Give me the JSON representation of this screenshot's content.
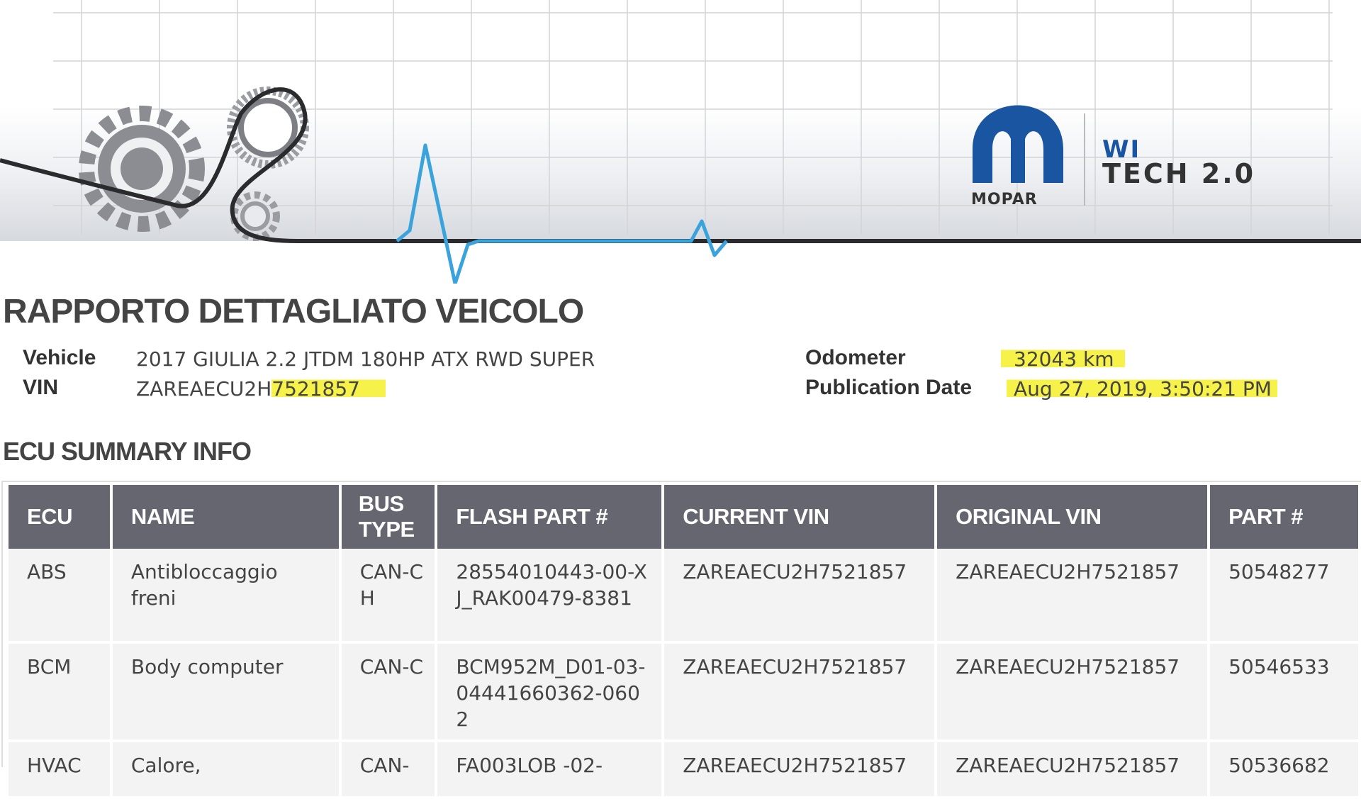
{
  "branding": {
    "logo_word": "MOPAR",
    "product_prefix": "WI",
    "product_name": "TECH 2.0"
  },
  "report": {
    "title": "RAPPORTO DETTAGLIATO VEICOLO",
    "vehicle_label": "Vehicle",
    "vehicle_value": "2017 GIULIA 2.2 JTDM 180HP ATX RWD SUPER",
    "vin_label": "VIN",
    "vin_prefix": "ZAREAECU2H",
    "vin_suffix": "7521857",
    "odometer_label": "Odometer",
    "odometer_value": "32043 km",
    "publication_label": "Publication Date",
    "publication_value": "Aug 27, 2019, 3:50:21 PM"
  },
  "highlight_color": "#f6f24a",
  "ecu_summary": {
    "title": "ECU SUMMARY INFO",
    "columns": [
      "ECU",
      "NAME",
      "BUS TYPE",
      "FLASH PART #",
      "CURRENT VIN",
      "ORIGINAL VIN",
      "PART #"
    ],
    "rows": [
      [
        "ABS",
        "Antibloccaggio freni",
        "CAN-CH",
        "28554010443-00-XJ_RAK00479-8381",
        "ZAREAECU2H7521857",
        "ZAREAECU2H7521857",
        "50548277"
      ],
      [
        "BCM",
        "Body computer",
        "CAN-C",
        "BCM952M_D01-03-04441660362-0602",
        "ZAREAECU2H7521857",
        "ZAREAECU2H7521857",
        "50546533"
      ],
      [
        "HVAC",
        "Calore,",
        "CAN-",
        "FA003LOB -02-",
        "ZAREAECU2H7521857",
        "ZAREAECU2H7521857",
        "50536682"
      ]
    ]
  }
}
